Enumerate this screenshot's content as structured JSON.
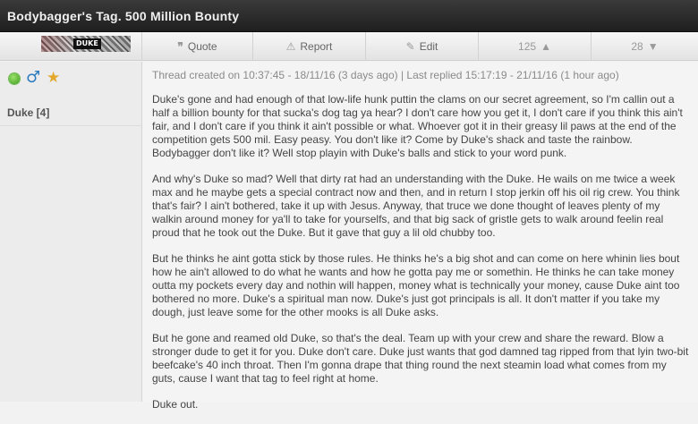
{
  "thread": {
    "title": "Bodybagger's Tag. 500 Million Bounty"
  },
  "user": {
    "banner_tag": "DUKE",
    "name": "Duke [4]",
    "status": "online",
    "gender_icon": "male-icon",
    "badge_icon": "star-icon"
  },
  "actions": {
    "quote_label": "Quote",
    "report_label": "Report",
    "edit_label": "Edit",
    "upvotes": "125",
    "downvotes": "28"
  },
  "meta": {
    "text": "Thread created on 10:37:45 - 18/11/16 (3 days ago) | Last replied 15:17:19 - 21/11/16 (1 hour ago)"
  },
  "post": {
    "paragraphs": [
      "Duke's gone and had enough of that low-life hunk puttin the clams on our secret agreement, so I'm callin out a half a billion bounty for that sucka's dog tag ya hear? I don't care how you get it, I don't care if you think this ain't fair, and I don't care if you think it ain't possible or what. Whoever got it in their greasy lil paws at the end of the competition gets 500 mil. Easy peasy. You don't like it? Come by Duke's shack and taste the rainbow. Bodybagger don't like it? Well stop playin with Duke's balls and stick to your word punk.",
      "And why's Duke so mad? Well that dirty rat had an understanding with the Duke. He wails on me twice a week max and he maybe gets a special contract now and then, and in return I stop jerkin off his oil rig crew.  You think that's fair? I ain't bothered, take it up with Jesus. Anyway, that truce we done thought of leaves plenty of my walkin around money for ya'll to take for yourselfs, and that big sack of gristle gets to walk around feelin real proud that he took out the Duke.  But it gave that guy a lil old chubby too.",
      "But he thinks he aint gotta stick by those rules. He thinks he's a big shot and can come on here whinin lies bout how he ain't allowed to do what he wants and how he gotta pay me or somethin. He thinks he can take money outta my pockets every day and nothin will happen, money what is technically your money, cause Duke aint too bothered no more. Duke's a spiritual man now. Duke's just got principals is all. It don't matter if you take my dough, just leave some for the other mooks is all Duke asks.",
      "But he gone and reamed old Duke, so that's the deal. Team up with your crew and share the reward. Blow a stronger dude to get it for you. Duke don't care. Duke just wants that god damned tag ripped from that lyin two-bit beefcake's 40 inch throat. Then I'm gonna drape that thing round the next steamin load what comes from my guts, cause I want that tag to feel right at home.",
      "Duke out."
    ]
  },
  "colors": {
    "title_bar": "#2a2a2a",
    "online": "#4caf2a",
    "male": "#2d7bbf",
    "star": "#e2a92d"
  }
}
